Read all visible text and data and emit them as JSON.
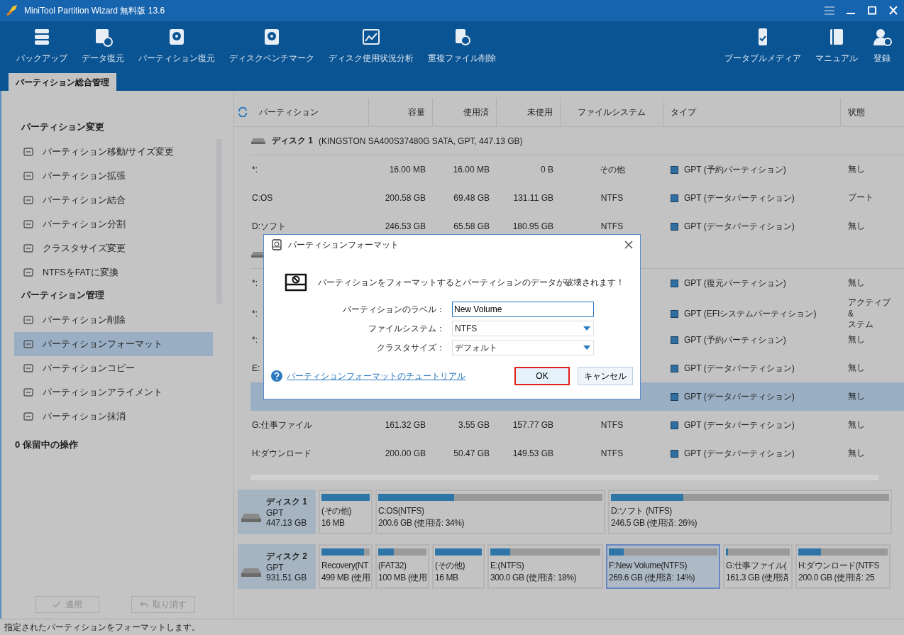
{
  "window": {
    "title": "MiniTool Partition Wizard 無料版 13.6"
  },
  "toolbar": {
    "left": [
      {
        "label": "バックアップ"
      },
      {
        "label": "データ復元"
      },
      {
        "label": "パーティション復元"
      },
      {
        "label": "ディスクベンチマーク"
      },
      {
        "label": "ディスク使用状況分析"
      },
      {
        "label": "重複ファイル削除"
      }
    ],
    "right": [
      {
        "label": "ブータブルメディア"
      },
      {
        "label": "マニュアル"
      },
      {
        "label": "登録"
      }
    ]
  },
  "tabs": [
    {
      "label": "パーティション総合管理",
      "selected": true
    }
  ],
  "sidebar": {
    "sections": [
      {
        "heading": "パーティション変更",
        "items": [
          {
            "label": "パーティション移動/サイズ変更",
            "selected": false
          },
          {
            "label": "パーティション拡張",
            "selected": false
          },
          {
            "label": "パーティション結合",
            "selected": false
          },
          {
            "label": "パーティション分割",
            "selected": false
          },
          {
            "label": "クラスタサイズ変更",
            "selected": false
          },
          {
            "label": "NTFSをFATに変換",
            "selected": false
          }
        ]
      },
      {
        "heading": "パーティション管理",
        "items": [
          {
            "label": "パーティション削除",
            "selected": false
          },
          {
            "label": "パーティションフォーマット",
            "selected": true
          },
          {
            "label": "パーティションコピー",
            "selected": false
          },
          {
            "label": "パーティションアライメント",
            "selected": false
          },
          {
            "label": "パーティション抹消",
            "selected": false
          }
        ]
      }
    ],
    "pending": "0 保留中の操作",
    "buttons": [
      {
        "label": "適用",
        "disabled": true
      },
      {
        "label": "取り消す",
        "disabled": true
      }
    ]
  },
  "table": {
    "columns": [
      "パーティション",
      "容量",
      "使用済",
      "未使用",
      "ファイルシステム",
      "タイプ",
      "状態"
    ],
    "groups": [
      {
        "name": "ディスク 1",
        "detail": "(KINGSTON SA400S37480G SATA, GPT, 447.13 GB)",
        "rows": [
          {
            "partition": "*:",
            "capacity": "16.00 MB",
            "used": "16.00 MB",
            "unused": "0 B",
            "fs": "その他",
            "type": "GPT (予約パーティション)",
            "status": "無し",
            "selected": false
          },
          {
            "partition": "C:OS",
            "capacity": "200.58 GB",
            "used": "69.48 GB",
            "unused": "131.11 GB",
            "fs": "NTFS",
            "type": "GPT (データパーティション)",
            "status": "ブート",
            "selected": false
          },
          {
            "partition": "D:ソフト",
            "capacity": "246.53 GB",
            "used": "65.58 GB",
            "unused": "180.95 GB",
            "fs": "NTFS",
            "type": "GPT (データパーティション)",
            "status": "無し",
            "selected": false
          }
        ]
      },
      {
        "rows": [
          {
            "partition": "*:",
            "type": "GPT (復元パーティション)",
            "status": "無し",
            "selected": false
          },
          {
            "partition": "*:",
            "type": "GPT (EFIシステムパーティション)",
            "status": "アクティブ &\nステム",
            "selected": false
          },
          {
            "partition": "*:",
            "type": "GPT (予約パーティション)",
            "status": "無し",
            "selected": false
          },
          {
            "partition": "E:",
            "type": "GPT (データパーティション)",
            "status": "無し",
            "selected": false
          },
          {
            "type": "GPT (データパーティション)",
            "status": "無し",
            "selected": true
          },
          {
            "partition": "G:仕事ファイル",
            "capacity": "161.32 GB",
            "used": "3.55 GB",
            "unused": "157.77 GB",
            "fs": "NTFS",
            "type": "GPT (データパーティション)",
            "status": "無し",
            "selected": false
          },
          {
            "partition": "H:ダウンロード",
            "capacity": "200.00 GB",
            "used": "50.47 GB",
            "unused": "149.53 GB",
            "fs": "NTFS",
            "type": "GPT (データパーティション)",
            "status": "無し",
            "selected": false
          }
        ]
      }
    ]
  },
  "disk_map": [
    {
      "name": "ディスク 1",
      "style": "GPT",
      "size": "447.13 GB",
      "partitions": [
        {
          "label": "(その他)",
          "detail": "16 MB",
          "level": 1.0,
          "selected": false
        },
        {
          "label": "C:OS(NTFS)",
          "detail": "200.6 GB (使用済: 34%)",
          "level": 0.34,
          "selected": false
        },
        {
          "label": "D:ソフト (NTFS)",
          "detail": "246.5 GB (使用済: 26%)",
          "level": 0.26,
          "selected": false
        }
      ]
    },
    {
      "name": "ディスク 2",
      "style": "GPT",
      "size": "931.51 GB",
      "partitions": [
        {
          "label": "Recovery(NT",
          "detail": "499 MB (使用",
          "level": 0.88,
          "selected": false
        },
        {
          "label": "(FAT32)",
          "detail": "100 MB (使用",
          "level": 0.32,
          "selected": false
        },
        {
          "label": "(その他)",
          "detail": "16 MB",
          "level": 1.0,
          "selected": false
        },
        {
          "label": "E:(NTFS)",
          "detail": "300.0 GB (使用済: 18%)",
          "level": 0.18,
          "selected": false
        },
        {
          "label": "F:New Volume(NTFS)",
          "detail": "269.6 GB (使用済: 14%)",
          "level": 0.14,
          "selected": true
        },
        {
          "label": "G:仕事ファイル(",
          "detail": "161.3 GB (使用済",
          "level": 0.03,
          "selected": false
        },
        {
          "label": "H:ダウンロード(NTFS",
          "detail": "200.0 GB (使用済: 25",
          "level": 0.25,
          "selected": false
        }
      ]
    }
  ],
  "dialog": {
    "title": "パーティションフォーマット",
    "message": "パーティションをフォーマットするとパーティションのデータが破壊されます！",
    "fields": [
      {
        "kind": "text",
        "label": "パーティションのラベル：",
        "value": "New Volume"
      },
      {
        "kind": "select",
        "label": "ファイルシステム：",
        "value": "NTFS"
      },
      {
        "kind": "select",
        "label": "クラスタサイズ：",
        "value": "デフォルト"
      }
    ],
    "link": "パーティションフォーマットのチュートリアル",
    "ok": {
      "label": "OK",
      "focused": true
    },
    "cancel": "キャンセル"
  },
  "status_bar": "指定されたパーティションをフォーマットします。"
}
